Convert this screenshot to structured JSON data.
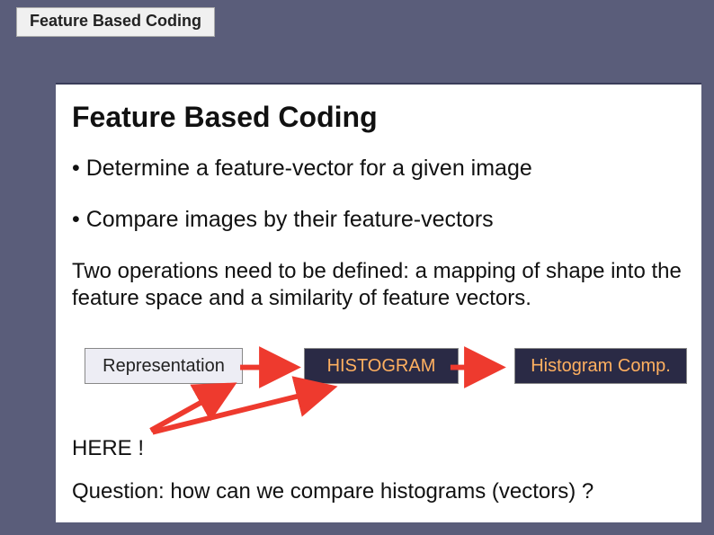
{
  "header": {
    "tab_label": "Feature Based Coding"
  },
  "slide": {
    "title": "Feature Based Coding",
    "bullet_1": "• Determine a feature-vector for a given image",
    "bullet_2": "• Compare images by their feature-vectors",
    "paragraph": "Two operations need to be defined: a mapping of shape into the feature space and a similarity of feature vectors.",
    "boxes": {
      "representation": "Representation",
      "histogram": "HISTOGRAM",
      "histogram_comp": "Histogram Comp."
    },
    "here_label": "HERE !",
    "question": "Question: how can we  compare histograms (vectors) ?"
  },
  "colors": {
    "background": "#5a5d7a",
    "box_dark_bg": "#2a2a45",
    "box_dark_text": "#ffb060",
    "arrow": "#ee3a2e"
  }
}
